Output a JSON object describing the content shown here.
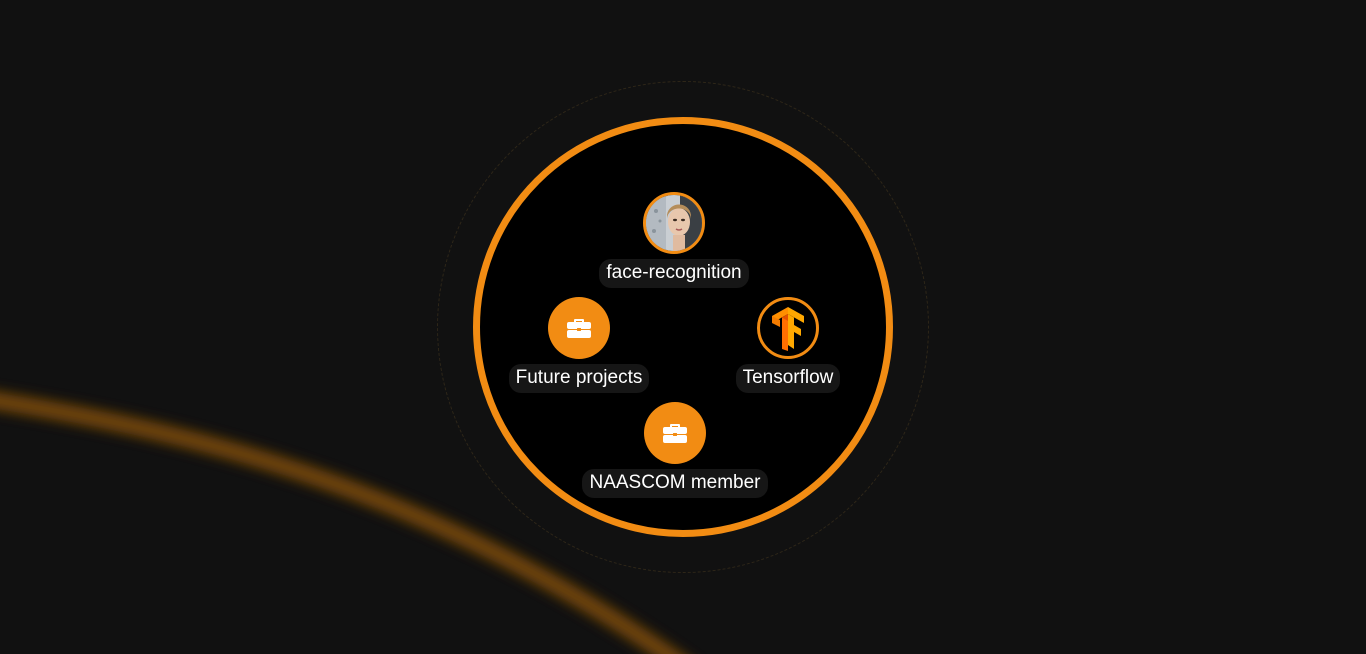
{
  "colors": {
    "accent": "#f28c13",
    "background": "#111111",
    "circle_fill": "#000000",
    "label_bg": "#161616",
    "label_text": "#ffffff"
  },
  "nodes": {
    "face_recognition": {
      "label": "face-recognition",
      "icon": "face-photo-icon"
    },
    "future_projects": {
      "label": "Future projects",
      "icon": "briefcase-icon"
    },
    "tensorflow": {
      "label": "Tensorflow",
      "icon": "tensorflow-logo-icon"
    },
    "naascom_member": {
      "label": "NAASCOM member",
      "icon": "briefcase-icon"
    }
  }
}
